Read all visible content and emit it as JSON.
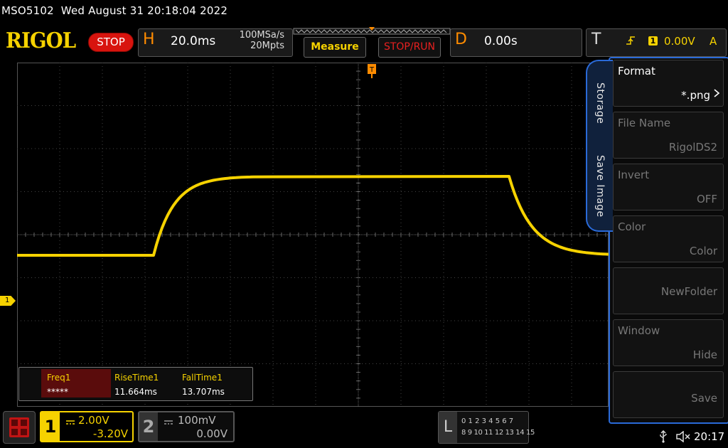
{
  "topbar": {
    "model": "MSO5102",
    "datetime": "Wed August 31 20:18:04 2022"
  },
  "header": {
    "brand": "RIGOL",
    "run_state": "STOP",
    "horizontal": {
      "letter": "H",
      "timebase": "20.0ms",
      "sample_rate": "100MSa/s",
      "memory_depth": "20Mpts"
    },
    "measure_button": "Measure",
    "stoprun_button": "STOP/RUN",
    "delay": {
      "letter": "D",
      "value": "0.00s"
    },
    "trigger": {
      "letter": "T",
      "source": "1",
      "level": "0.00V",
      "mode": "A"
    }
  },
  "side_menu": {
    "tabs": [
      "Storage",
      "Save Image"
    ],
    "items": [
      {
        "title": "Format",
        "value": "*.png",
        "state": "bright"
      },
      {
        "title": "File Name",
        "value": "RigolDS2",
        "state": "dim"
      },
      {
        "title": "Invert",
        "value": "OFF",
        "state": "dim"
      },
      {
        "title": "Color",
        "value": "Color",
        "state": "dim"
      },
      {
        "title": "",
        "value": "NewFolder",
        "state": "dim"
      },
      {
        "title": "Window",
        "value": "Hide",
        "state": "dim"
      },
      {
        "title": "",
        "value": "Save",
        "state": "dim"
      }
    ]
  },
  "measurements": [
    {
      "label": "Freq1",
      "value": "*****"
    },
    {
      "label": "RiseTime1",
      "value": "11.664ms"
    },
    {
      "label": "FallTime1",
      "value": "13.707ms"
    }
  ],
  "channel_marker": "1",
  "channels": {
    "ch1": {
      "number": "1",
      "scale": "2.00V",
      "offset": "-3.20V"
    },
    "ch2": {
      "number": "2",
      "scale": "100mV",
      "offset": "0.00V"
    }
  },
  "logic": {
    "letter": "L",
    "row1": "0 1 2 3  4 5 6 7",
    "row2": "8 9 10 11 12 13 14 15"
  },
  "status": {
    "time": "20:17"
  },
  "colors": {
    "ch1": "#f6d200",
    "accent_blue": "#2a6ad8",
    "stop_red": "#d8140e",
    "horizontal_orange": "#ff8c00"
  }
}
